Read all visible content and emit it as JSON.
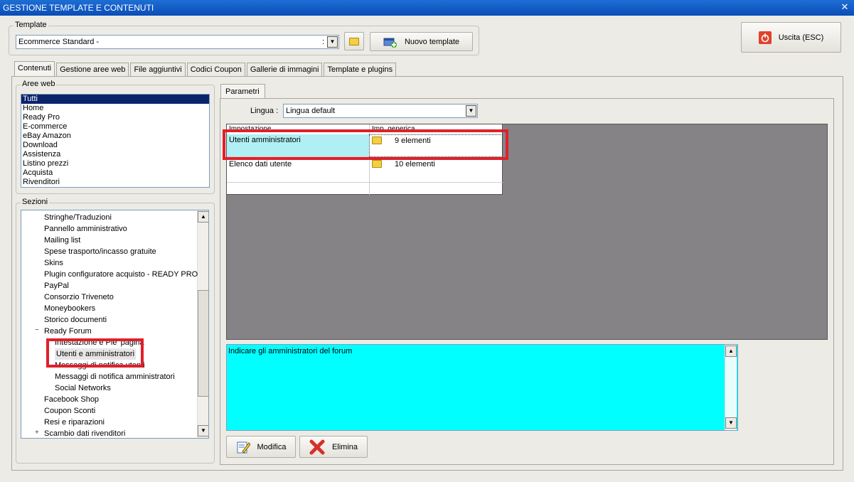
{
  "window": {
    "title": "GESTIONE TEMPLATE E CONTENUTI",
    "close_icon": "close-icon"
  },
  "template": {
    "group_label": "Template",
    "selected": "Ecommerce Standard -",
    "nuovo_label": "Nuovo template"
  },
  "exit_label": "Uscita (ESC)",
  "tabs": [
    {
      "label": "Contenuti",
      "active": true
    },
    {
      "label": "Gestione aree web"
    },
    {
      "label": "File aggiuntivi"
    },
    {
      "label": "Codici Coupon"
    },
    {
      "label": "Gallerie di immagini"
    },
    {
      "label": "Template e plugins"
    }
  ],
  "aree_web": {
    "label": "Aree web",
    "items": [
      "Tutti",
      "Home",
      "Ready Pro",
      "E-commerce",
      "eBay Amazon",
      "Download",
      "Assistenza",
      "Listino prezzi",
      "Acquista",
      "Rivenditori"
    ],
    "selected": "Tutti"
  },
  "sezioni": {
    "label": "Sezioni",
    "items": [
      {
        "label": "Stringhe/Traduzioni",
        "level": 1
      },
      {
        "label": "Pannello amministrativo",
        "level": 1
      },
      {
        "label": "Mailing list",
        "level": 1
      },
      {
        "label": "Spese trasporto/incasso gratuite",
        "level": 1
      },
      {
        "label": "Skins",
        "level": 1
      },
      {
        "label": "Plugin configuratore acquisto - READY PRO",
        "level": 1
      },
      {
        "label": "PayPal",
        "level": 1
      },
      {
        "label": "Consorzio Triveneto",
        "level": 1
      },
      {
        "label": "Moneybookers",
        "level": 1
      },
      {
        "label": "Storico documenti",
        "level": 1
      },
      {
        "label": "Ready Forum",
        "level": 1,
        "expanded": true
      },
      {
        "label": "Intestazione e Pie' pagina",
        "level": 2
      },
      {
        "label": "Utenti e amministratori",
        "level": 2,
        "selected": true
      },
      {
        "label": "Messaggi di notifica utenti",
        "level": 2
      },
      {
        "label": "Messaggi di notifica amministratori",
        "level": 2
      },
      {
        "label": "Social Networks",
        "level": 2
      },
      {
        "label": "Facebook Shop",
        "level": 1
      },
      {
        "label": "Coupon Sconti",
        "level": 1
      },
      {
        "label": "Resi e riparazioni",
        "level": 1
      },
      {
        "label": "Scambio dati rivenditori",
        "level": 1,
        "collapsed": true
      }
    ]
  },
  "parametri": {
    "tab_label": "Parametri",
    "lingua_label": "Lingua :",
    "lingua_value": "Lingua default",
    "grid": {
      "headers": [
        "Impostazione",
        "Imp. generica"
      ],
      "rows": [
        {
          "name": "Utenti amministratori",
          "value": "9 elementi"
        },
        {
          "name": "Elenco dati utente",
          "value": "10 elementi"
        }
      ]
    },
    "description": "Indicare gli amministratori del forum",
    "modifica_label": "Modifica",
    "elimina_label": "Elimina"
  },
  "colors": {
    "title_bar": "#0a4cb8",
    "selected_row": "#b0f0f4",
    "description_bg": "#00ffff",
    "highlight": "#e0202a"
  }
}
